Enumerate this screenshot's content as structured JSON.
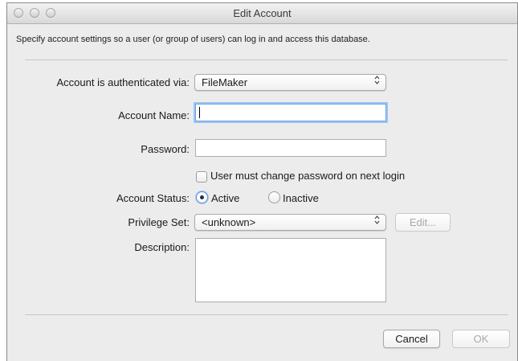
{
  "window": {
    "title": "Edit Account"
  },
  "instructions": "Specify account settings so a user (or group of users) can log in and access this database.",
  "auth": {
    "label": "Account is authenticated via:",
    "value": "FileMaker"
  },
  "account_name": {
    "label": "Account Name:",
    "value": ""
  },
  "password": {
    "label": "Password:",
    "value": ""
  },
  "must_change": {
    "label": "User must change password on next login",
    "checked": false
  },
  "status": {
    "label": "Account Status:",
    "active_label": "Active",
    "inactive_label": "Inactive",
    "selected": "Active"
  },
  "privilege": {
    "label": "Privilege Set:",
    "value": "<unknown>",
    "edit_label": "Edit..."
  },
  "description": {
    "label": "Description:",
    "value": ""
  },
  "buttons": {
    "cancel": "Cancel",
    "ok": "OK"
  },
  "icons": {
    "popup_arrows": "⌃⌄"
  },
  "colors": {
    "focus_ring": "#9cc4f3",
    "radio_selected": "#5b8fd6"
  }
}
